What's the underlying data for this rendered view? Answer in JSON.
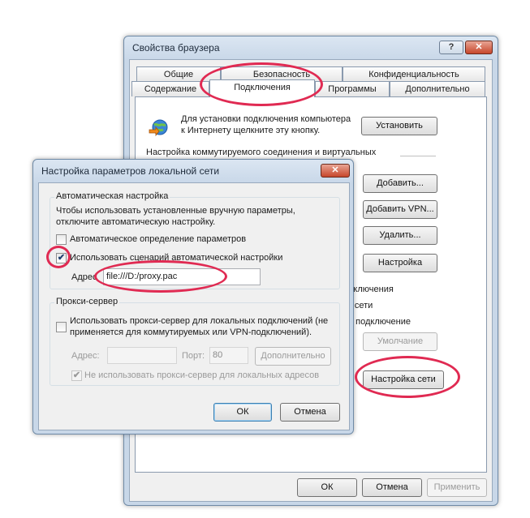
{
  "back_dialog": {
    "title": "Свойства браузера",
    "help_label": "?",
    "close_label": "✕",
    "tabs_row1": [
      "Общие",
      "Безопасность",
      "Конфиденциальность"
    ],
    "tabs_row2": [
      "Содержание",
      "Подключения",
      "Программы",
      "Дополнительно"
    ],
    "active_tab": "Подключения",
    "setup_text_line1": "Для установки подключения компьютера",
    "setup_text_line2": "к Интернету щелкните эту кнопку.",
    "setup_button": "Установить",
    "dialup_label": "Настройка коммутируемого соединения и виртуальных",
    "add_button": "Добавить...",
    "add_vpn_button": "Добавить VPN...",
    "remove_button": "Удалить...",
    "settings_button": "Настройка",
    "partial_text_1": "дключения",
    "partial_text_2": "к сети",
    "partial_text_3": "о подключение",
    "default_button": "Умолчание",
    "lan_settings_button": "Настройка сети",
    "ok_button": "ОК",
    "cancel_button": "Отмена",
    "apply_button": "Применить"
  },
  "lan_dialog": {
    "title": "Настройка параметров локальной сети",
    "close_label": "✕",
    "auto_group_title": "Автоматическая настройка",
    "auto_desc_line1": "Чтобы использовать установленные вручную параметры,",
    "auto_desc_line2": "отключите автоматическую настройку.",
    "auto_detect_label": "Автоматическое определение параметров",
    "auto_detect_checked": false,
    "use_script_label": "Использовать сценарий автоматической настройки",
    "use_script_checked": true,
    "address_label": "Адрес",
    "address_value": "file:///D:/proxy.pac",
    "proxy_group_title": "Прокси-сервер",
    "use_proxy_line1": "Использовать прокси-сервер для локальных подключений (не",
    "use_proxy_line2": "применяется для коммутируемых или VPN-подключений).",
    "use_proxy_checked": false,
    "proxy_address_label": "Адрес:",
    "proxy_address_value": "",
    "port_label": "Порт:",
    "port_value": "80",
    "advanced_button": "Дополнительно",
    "bypass_label": "Не использовать прокси-сервер для локальных адресов",
    "bypass_checked": true,
    "ok_button": "ОК",
    "cancel_button": "Отмена"
  },
  "check_glyph": "✔",
  "colors": {
    "highlight_ring": "#e02a52",
    "title_bar": "#c8d7e8",
    "default_button_border": "#3c7fb1"
  }
}
